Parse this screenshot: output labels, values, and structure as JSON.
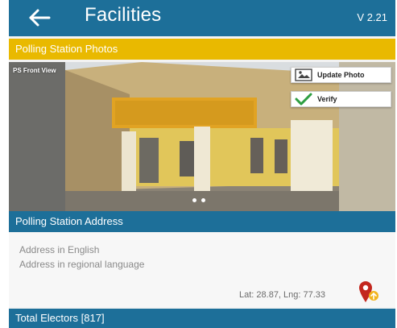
{
  "appbar": {
    "title": "Facilities",
    "version": "V 2.21",
    "back_icon": "arrow-left-icon"
  },
  "photos_section": {
    "heading": "Polling Station Photos",
    "photo_label": "PS Front View",
    "update_photo_label": "Update Photo",
    "verify_label": "Verify",
    "carousel": {
      "pages": 2,
      "current": 1
    }
  },
  "address_section": {
    "heading": "Polling Station Address",
    "address_english": "Address in English",
    "address_regional": "Address in regional language",
    "coordinates": "Lat: 28.87, Lng: 77.33",
    "location_icon": "map-pin-icon"
  },
  "electors_section": {
    "heading": "Total Electors [817]"
  },
  "colors": {
    "primary": "#1d6f99",
    "accent": "#e9b900",
    "verify_green": "#2e9e41",
    "pin_red": "#c3271e"
  }
}
